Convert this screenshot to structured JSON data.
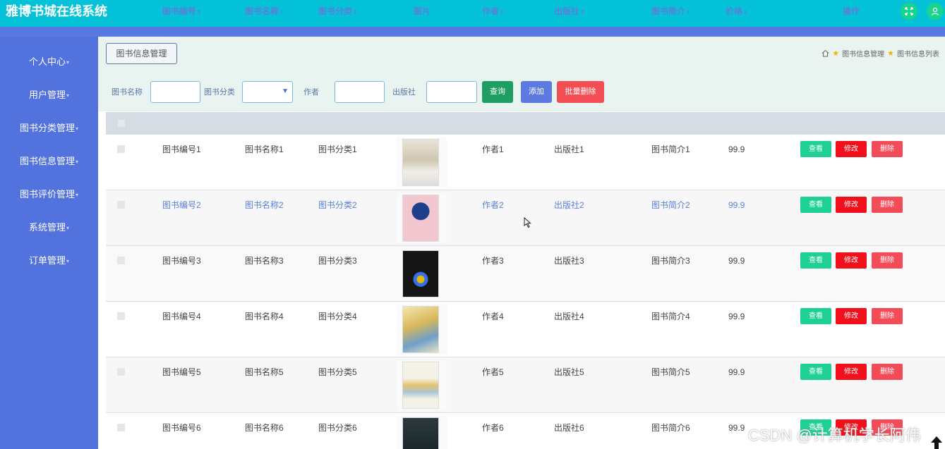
{
  "header": {
    "title": "雅博书城在线系统",
    "fullscreen_icon": "fullscreen-icon",
    "user_icon": "user-icon",
    "accent": "#04c3d9"
  },
  "sidebar": {
    "items": [
      {
        "label": "个人中心"
      },
      {
        "label": "用户管理"
      },
      {
        "label": "图书分类管理"
      },
      {
        "label": "图书信息管理"
      },
      {
        "label": "图书评价管理"
      },
      {
        "label": "系统管理"
      },
      {
        "label": "订单管理"
      }
    ]
  },
  "panel": {
    "title": "图书信息管理"
  },
  "breadcrumb": {
    "items": [
      "图书信息管理",
      "图书信息列表"
    ]
  },
  "search": {
    "name_label": "图书名称",
    "category_label": "图书分类",
    "author_label": "作者",
    "publisher_label": "出版社",
    "name_value": "",
    "category_value": "",
    "author_value": "",
    "publisher_value": "",
    "query_label": "查询",
    "add_label": "添加",
    "batch_delete_label": "批量删除"
  },
  "table": {
    "columns": [
      "图书编号",
      "图书名称",
      "图书分类",
      "图片",
      "作者",
      "出版社",
      "图书简介",
      "价格",
      "操作"
    ],
    "rows": [
      {
        "code": "图书编号1",
        "name": "图书名称1",
        "category": "图书分类1",
        "author": "作者1",
        "publisher": "出版社1",
        "intro": "图书简介1",
        "price": "99.9",
        "cover_color": "#e9e4d8"
      },
      {
        "code": "图书编号2",
        "name": "图书名称2",
        "category": "图书分类2",
        "author": "作者2",
        "publisher": "出版社2",
        "intro": "图书简介2",
        "price": "99.9",
        "cover_color": "#f3c7cf"
      },
      {
        "code": "图书编号3",
        "name": "图书名称3",
        "category": "图书分类3",
        "author": "作者3",
        "publisher": "出版社3",
        "intro": "图书简介3",
        "price": "99.9",
        "cover_color": "#151515"
      },
      {
        "code": "图书编号4",
        "name": "图书名称4",
        "category": "图书分类4",
        "author": "作者4",
        "publisher": "出版社4",
        "intro": "图书简介4",
        "price": "99.9",
        "cover_color": "#d9b75a"
      },
      {
        "code": "图书编号5",
        "name": "图书名称5",
        "category": "图书分类5",
        "author": "作者5",
        "publisher": "出版社5",
        "intro": "图书简介5",
        "price": "99.9",
        "cover_color": "#f4f1e6"
      },
      {
        "code": "图书编号6",
        "name": "图书名称6",
        "category": "图书分类6",
        "author": "作者6",
        "publisher": "出版社6",
        "intro": "图书简介6",
        "price": "99.9",
        "cover_color": "#1d2a2e"
      }
    ],
    "actions": {
      "view": "查看",
      "edit": "修改",
      "delete": "删除"
    }
  },
  "watermark": "CSDN @计算机学长阿伟"
}
